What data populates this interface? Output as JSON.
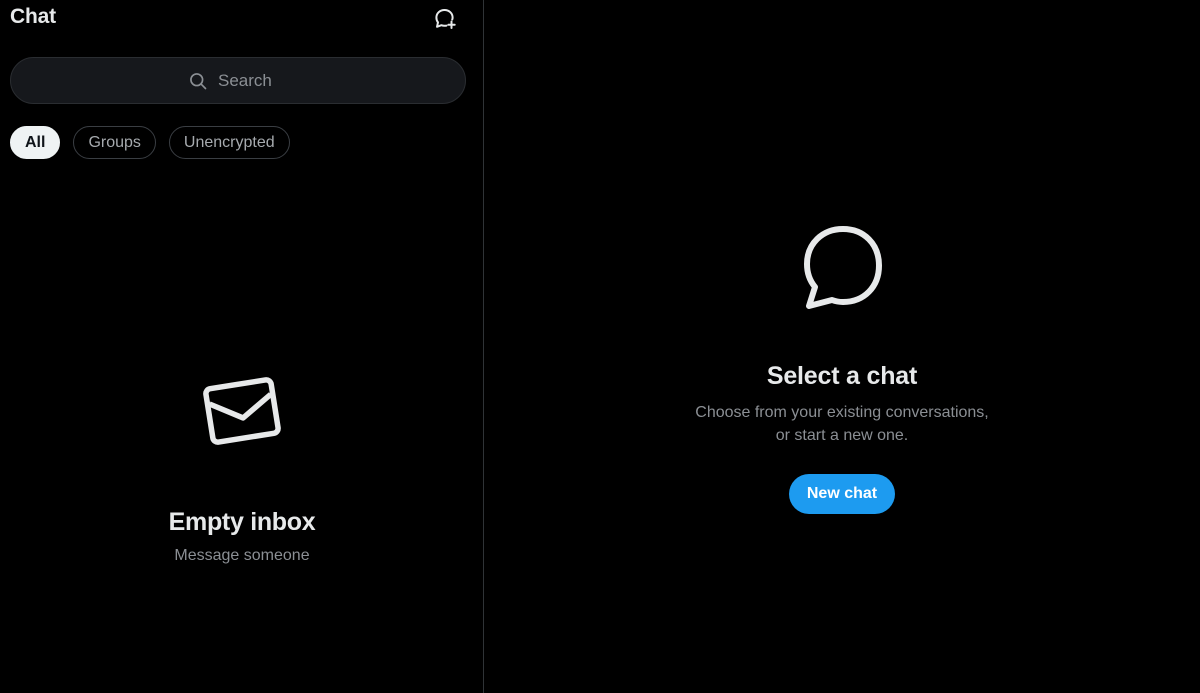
{
  "sidebar": {
    "title": "Chat",
    "new_chat_icon": "new-chat-bubble-plus-icon",
    "search": {
      "placeholder": "Search",
      "value": "",
      "icon": "search-icon"
    },
    "filters": [
      {
        "label": "All",
        "active": true
      },
      {
        "label": "Groups",
        "active": false
      },
      {
        "label": "Unencrypted",
        "active": false
      }
    ],
    "empty": {
      "icon": "envelope-icon",
      "title": "Empty inbox",
      "subtitle": "Message someone"
    }
  },
  "main": {
    "icon": "chat-bubble-icon",
    "title": "Select a chat",
    "subtitle_line1": "Choose from your existing conversations,",
    "subtitle_line2": "or start a new one.",
    "button_label": "New chat"
  },
  "colors": {
    "background": "#000000",
    "accent": "#1d9bf0",
    "text_primary": "#e7e9ea",
    "text_secondary": "#8b8f94",
    "divider": "#2f3336"
  }
}
